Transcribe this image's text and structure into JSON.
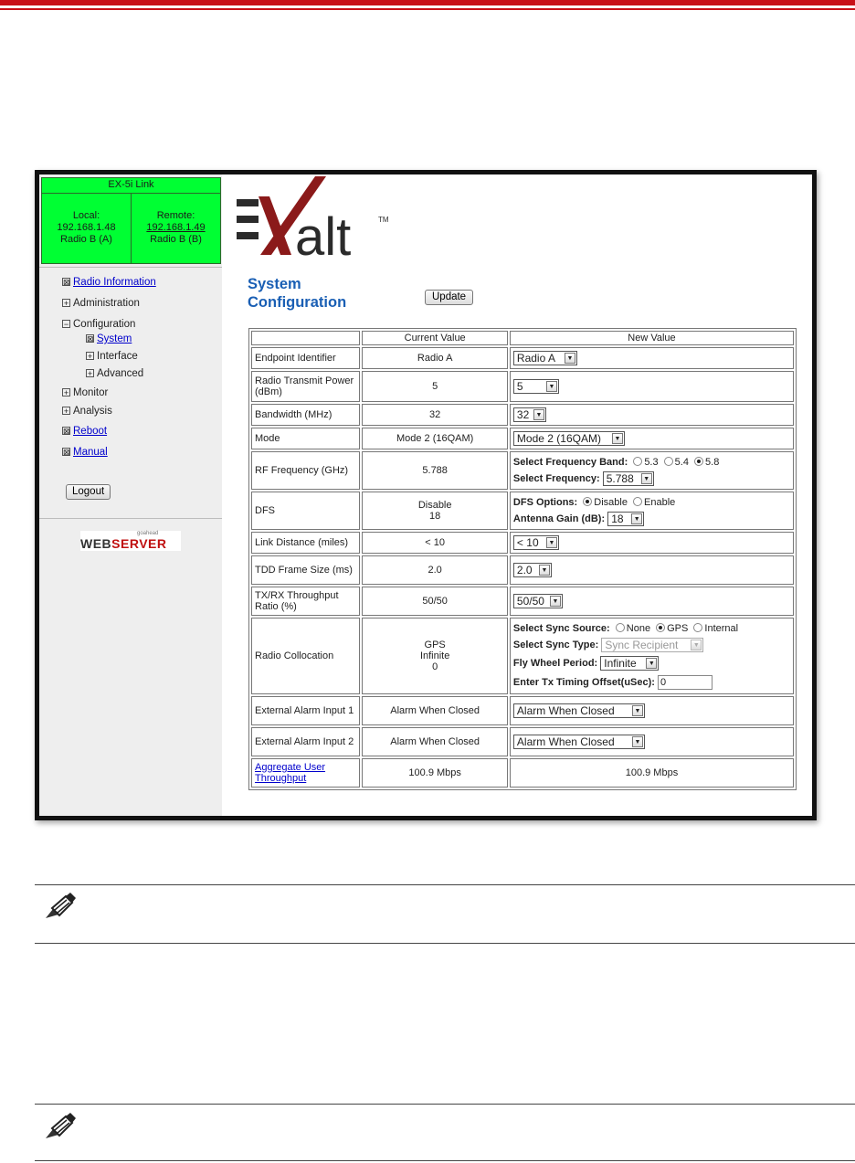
{
  "link_status": {
    "title": "EX-5i Link",
    "local_label": "Local:",
    "local_ip": "192.168.1.48",
    "local_radio": "Radio B (A)",
    "remote_label": "Remote:",
    "remote_ip": "192.168.1.49",
    "remote_radio": "Radio B (B)"
  },
  "nav": {
    "items": [
      {
        "label": "Radio Information",
        "marker": "⊠",
        "link": true
      },
      {
        "label": "Administration",
        "marker": "+",
        "link": false
      },
      {
        "label": "Configuration",
        "marker": "−",
        "link": false
      },
      {
        "label": "System",
        "marker": "⊠",
        "link": true
      },
      {
        "label": "Interface",
        "marker": "+",
        "link": false
      },
      {
        "label": "Advanced",
        "marker": "+",
        "link": false
      },
      {
        "label": "Monitor",
        "marker": "+",
        "link": false
      },
      {
        "label": "Analysis",
        "marker": "+",
        "link": false
      },
      {
        "label": "Reboot",
        "marker": "⊠",
        "link": true
      },
      {
        "label": "Manual",
        "marker": "⊠",
        "link": true
      }
    ],
    "logout_label": "Logout"
  },
  "webserver_logo": {
    "small": "goahead",
    "web": "WEB",
    "server": "SERVER"
  },
  "brand": {
    "logo_text": "alt",
    "tm": "TM",
    "brand_red": "#8b1a1a",
    "brand_dark": "#2b2b2b"
  },
  "page": {
    "title_line1": "System",
    "title_line2": "Configuration",
    "update_label": "Update"
  },
  "table": {
    "header_current": "Current Value",
    "header_new": "New Value",
    "endpoint": {
      "label": "Endpoint Identifier",
      "current": "Radio A",
      "new": "Radio A"
    },
    "power": {
      "label": "Radio Transmit Power (dBm)",
      "current": "5",
      "new": "5"
    },
    "bandwidth": {
      "label": "Bandwidth (MHz)",
      "current": "32",
      "new": "32"
    },
    "mode": {
      "label": "Mode",
      "current": "Mode 2 (16QAM)",
      "new": "Mode 2 (16QAM)"
    },
    "rf": {
      "label": "RF Frequency (GHz)",
      "current": "5.788",
      "band_label": "Select Frequency Band:",
      "band_opts": [
        "5.3",
        "5.4",
        "5.8"
      ],
      "band_selected": "5.8",
      "freq_label": "Select Frequency:",
      "freq_value": "5.788"
    },
    "dfs": {
      "label": "DFS",
      "current_line1": "Disable",
      "current_line2": "18",
      "options_label": "DFS Options:",
      "opt_disable": "Disable",
      "opt_enable": "Enable",
      "selected": "Disable",
      "gain_label": "Antenna Gain (dB):",
      "gain_value": "18"
    },
    "distance": {
      "label": "Link Distance (miles)",
      "current": "< 10",
      "new": "< 10"
    },
    "tdd": {
      "label": "TDD Frame Size (ms)",
      "current": "2.0",
      "new": "2.0"
    },
    "ratio": {
      "label": "TX/RX Throughput Ratio (%)",
      "current": "50/50",
      "new": "50/50"
    },
    "colloc": {
      "label": "Radio Collocation",
      "current_line1": "GPS",
      "current_line2": "Infinite",
      "current_line3": "0",
      "source_label": "Select Sync Source:",
      "src_none": "None",
      "src_gps": "GPS",
      "src_internal": "Internal",
      "src_selected": "GPS",
      "type_label": "Select Sync Type:",
      "type_value": "Sync Recipient",
      "fly_label": "Fly Wheel Period:",
      "fly_value": "Infinite",
      "offset_label": "Enter Tx Timing Offset(uSec):",
      "offset_value": "0"
    },
    "alarm1": {
      "label": "External Alarm Input 1",
      "current": "Alarm When Closed",
      "new": "Alarm When Closed"
    },
    "alarm2": {
      "label": "External Alarm Input 2",
      "current": "Alarm When Closed",
      "new": "Alarm When Closed"
    },
    "throughput": {
      "label": "Aggregate User Throughput",
      "current": "100.9 Mbps",
      "new": "100.9 Mbps"
    }
  }
}
